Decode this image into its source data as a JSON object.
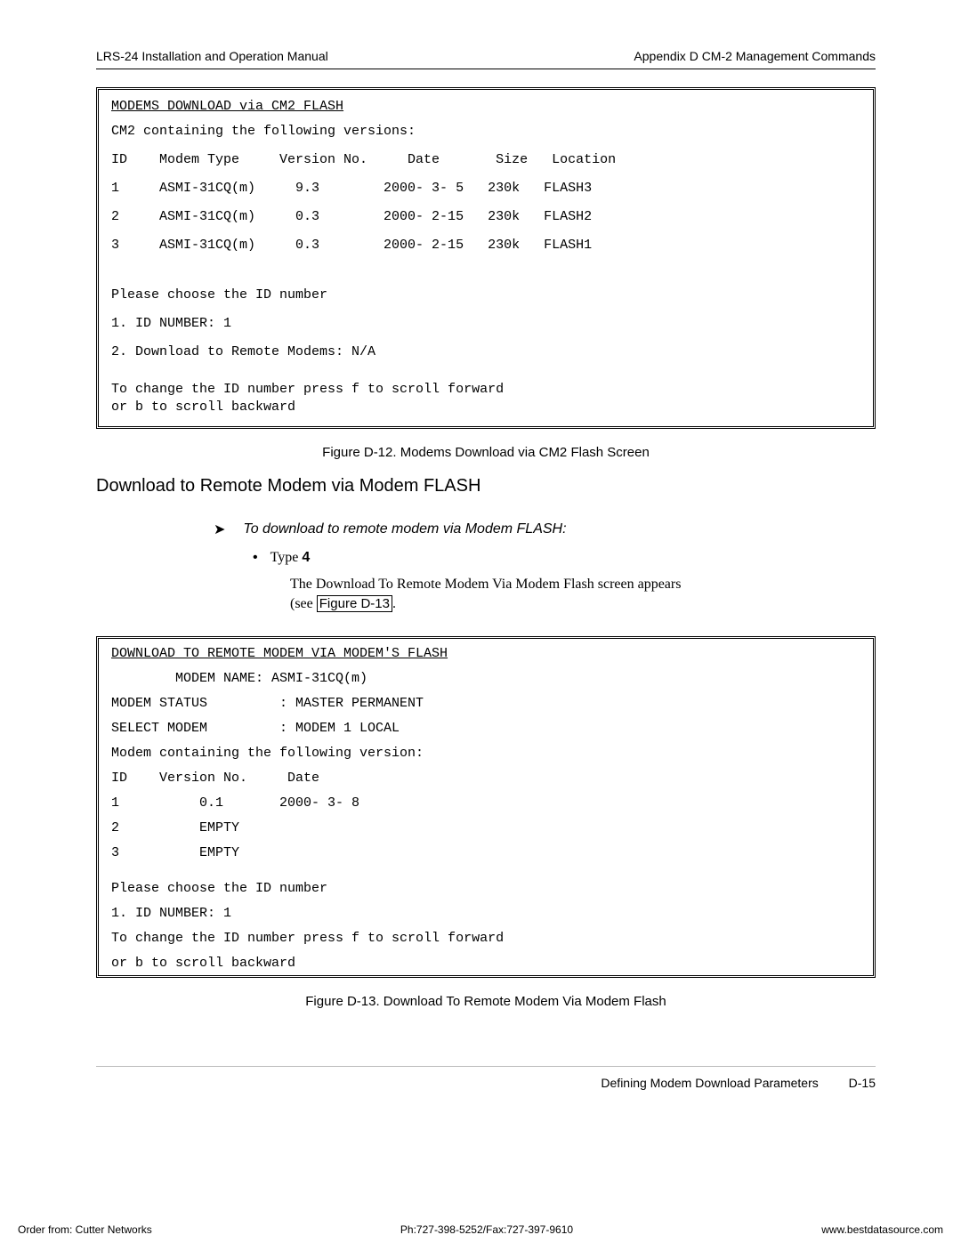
{
  "header": {
    "left": "LRS-24 Installation and Operation Manual",
    "right": "Appendix D  CM-2 Management Commands"
  },
  "screen1": {
    "title": "MODEMS DOWNLOAD via CM2 FLASH",
    "subtitle": "CM2 containing the following versions:",
    "cols": "ID    Modem Type     Version No.     Date       Size   Location",
    "rows": [
      "1     ASMI-31CQ(m)     9.3        2000- 3- 5   230k   FLASH3",
      "2     ASMI-31CQ(m)     0.3        2000- 2-15   230k   FLASH2",
      "3     ASMI-31CQ(m)     0.3        2000- 2-15   230k   FLASH1"
    ],
    "prompt": "Please choose the ID number",
    "opt1": "1. ID NUMBER: 1",
    "opt2": "2. Download to Remote Modems: N/A",
    "help1": "To change the ID number press f to scroll forward",
    "help2": "or b to scroll backward"
  },
  "caption1": "Figure D-12.  Modems Download via CM2 Flash Screen",
  "section_h3": "Download to Remote Modem via Modem FLASH",
  "instr": {
    "lead": "To download to remote modem via Modem FLASH:",
    "bullet_label": "Type ",
    "bullet_bold": "4",
    "result1": "The Download To Remote Modem Via Modem Flash screen appears",
    "result2a": "(see ",
    "result2_link": "Figure D-13",
    "result2b": "."
  },
  "screen2": {
    "title": "DOWNLOAD TO REMOTE MODEM VIA MODEM'S FLASH",
    "name": "        MODEM NAME: ASMI-31CQ(m)",
    "status": "MODEM STATUS         : MASTER PERMANENT",
    "select": "SELECT MODEM         : MODEM 1 LOCAL",
    "sub": "Modem containing the following version:",
    "cols": "ID    Version No.     Date",
    "rows": [
      "1          0.1       2000- 3- 8",
      "2          EMPTY",
      "3          EMPTY"
    ],
    "prompt": "Please choose the ID number",
    "opt1": "1. ID NUMBER: 1",
    "help1": "To change the ID number press f to scroll forward",
    "help2": "or b to scroll backward"
  },
  "caption2": "Figure D-13. Download To Remote Modem Via Modem Flash",
  "footer": {
    "text": "Defining Modem Download Parameters",
    "page": "D-15"
  },
  "bottom": {
    "left": "Order from: Cutter Networks",
    "mid": "Ph:727-398-5252/Fax:727-397-9610",
    "right": "www.bestdatasource.com"
  }
}
